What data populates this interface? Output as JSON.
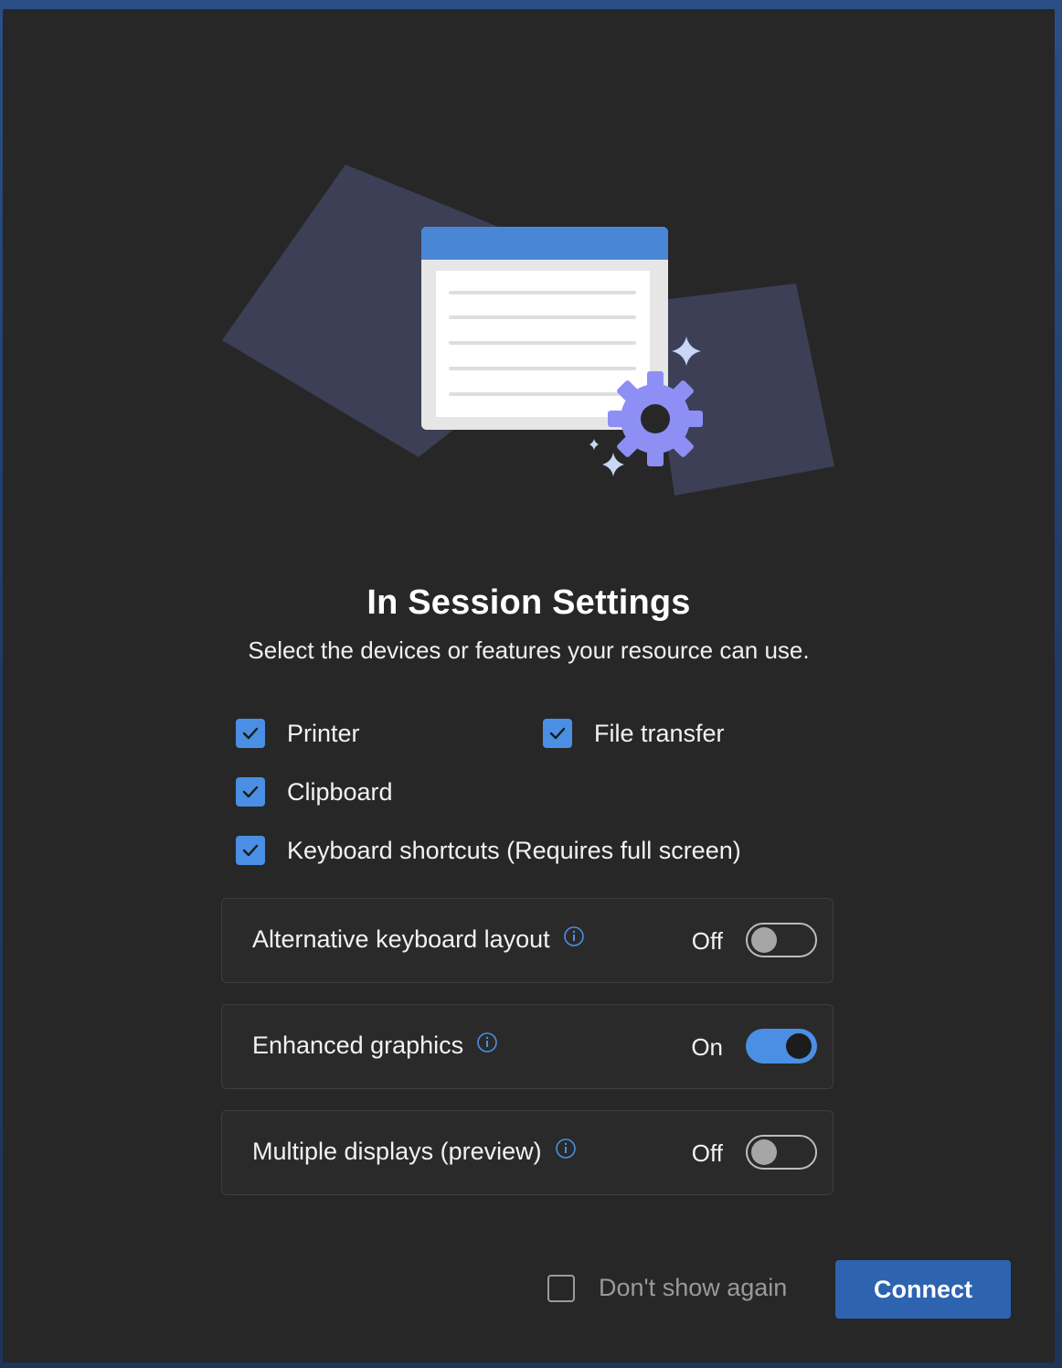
{
  "dialog": {
    "title": "In Session Settings",
    "subtitle": "Select the devices or features your resource can use."
  },
  "devices": [
    {
      "label": "Printer",
      "checked": true
    },
    {
      "label": "File transfer",
      "checked": true
    },
    {
      "label": "Clipboard",
      "checked": true
    },
    {
      "label": "Keyboard shortcuts (Requires full screen)",
      "checked": true
    }
  ],
  "settings": [
    {
      "label": "Alternative keyboard layout",
      "state": "Off",
      "enabled": false,
      "icon": "info-icon"
    },
    {
      "label": "Enhanced graphics",
      "state": "On",
      "enabled": true,
      "icon": "info-icon"
    },
    {
      "label": "Multiple displays (preview)",
      "state": "Off",
      "enabled": false,
      "icon": "info-icon"
    }
  ],
  "footer": {
    "dont_show_label": "Don't show again",
    "dont_show_checked": false,
    "connect_label": "Connect"
  },
  "colors": {
    "accent": "#4a8fe4",
    "button": "#2e63b0",
    "background": "#272727",
    "window_header": "#4a86d6",
    "gear": "#8d8ff5"
  }
}
